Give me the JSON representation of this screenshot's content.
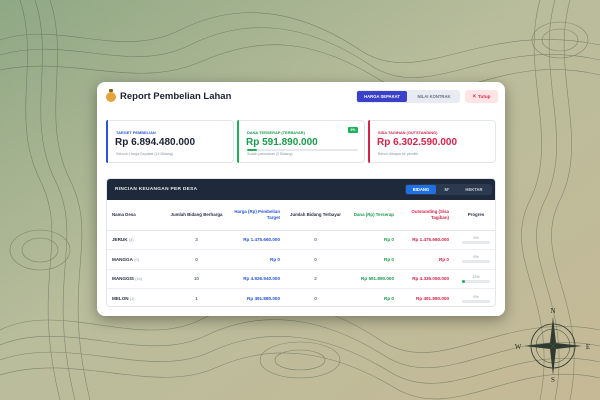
{
  "header": {
    "title": "Report Pembelian Lahan",
    "toggle": [
      "HARGA SEPAKAT",
      "NILAI KONTRAK"
    ],
    "close_label": "Tutup",
    "close_icon": "×"
  },
  "cards": {
    "target": {
      "label": "TARGET PEMBELIAN",
      "value": "Rp 6.894.480.000",
      "sub": "Seluruh Harga Sepakat (14 Bidang)"
    },
    "terserap": {
      "label": "DANA TERSERAP (TERBAYAR)",
      "value": "Rp 591.890.000",
      "sub": "Sudah pelunasan (2 Bidang)",
      "badge": "9%",
      "progress": 0.09
    },
    "sisa": {
      "label": "SISA TAGIHAN (OUTSTANDING)",
      "value": "Rp 6.302.590.000",
      "sub": "Belum dibayar ke pemilik"
    }
  },
  "table": {
    "title": "RINCIAN KEUANGAN PER DESA",
    "units": [
      "BIDANG",
      "M²",
      "HEKTAR"
    ],
    "columns": {
      "desa": "Nama Desa",
      "jb": "Jumlah Bidang Berharga",
      "harga": "Harga (Rp) Pembelian Target",
      "jbt": "Jumlah Bidang Terbayar",
      "dana": "Dana (Rp) Terserap",
      "out": "Outstanding (Sisa Tagihan)",
      "prog": "Progres"
    },
    "rows": [
      {
        "desa": "JERUK",
        "count": "(3)",
        "jb": "3",
        "harga": "Rp 1.475.660.000",
        "jbt": "0",
        "dana": "Rp 0",
        "out": "Rp 1.475.660.000",
        "pct": "0%",
        "progress": 0
      },
      {
        "desa": "MANGGA",
        "count": "(0)",
        "jb": "0",
        "harga": "Rp 0",
        "jbt": "0",
        "dana": "Rp 0",
        "out": "Rp 0",
        "pct": "0%",
        "progress": 0
      },
      {
        "desa": "MANGGIS",
        "count": "(10)",
        "jb": "10",
        "harga": "Rp 4.926.940.000",
        "jbt": "2",
        "dana": "Rp 591.890.000",
        "out": "Rp 4.335.050.000",
        "pct": "12%",
        "progress": 0.12
      },
      {
        "desa": "MELON",
        "count": "(1)",
        "jb": "1",
        "harga": "Rp 491.880.000",
        "jbt": "0",
        "dana": "Rp 0",
        "out": "Rp 491.880.000",
        "pct": "0%",
        "progress": 0
      }
    ]
  },
  "compass": {
    "north": "N",
    "south": "S",
    "east": "E",
    "west": "W"
  },
  "colors": {
    "accent": "#3a40c8",
    "blue": "#2a55d6",
    "green": "#1eb15a",
    "red": "#d4244a",
    "table_header": "#1e2a3c"
  },
  "icons": {
    "title": "money-bag-icon",
    "close": "close-icon",
    "compass": "compass-rose-icon"
  }
}
